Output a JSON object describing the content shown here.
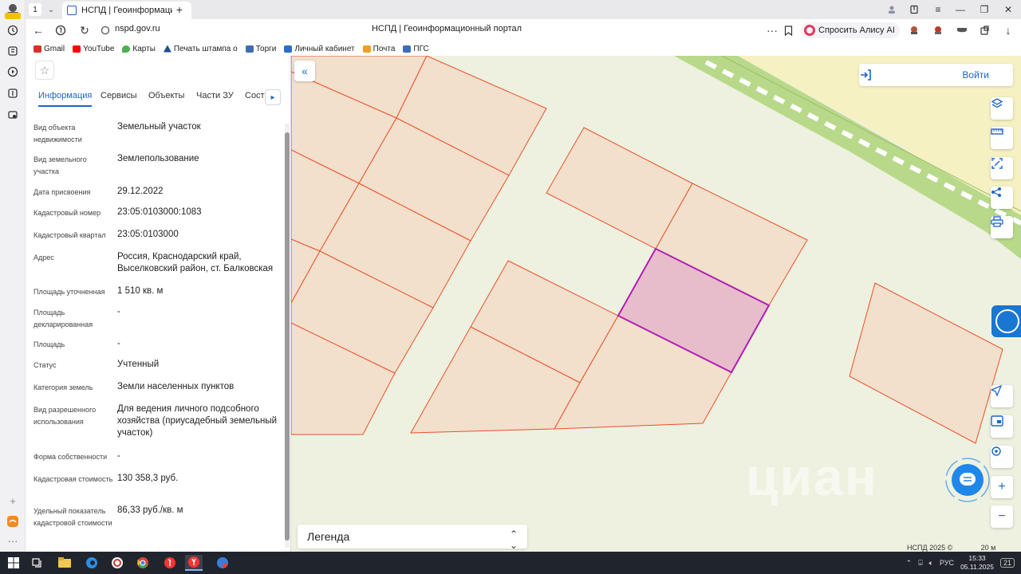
{
  "browser": {
    "profile_label": "Войти",
    "tab_count": "1",
    "active_tab_title": "НСПД | Геоинформацио",
    "url": "nspd.gov.ru",
    "page_title": "НСПД | Геоинформационный портал",
    "alisa_label": "Спросить Алису AI",
    "bookmarks": [
      {
        "label": "Gmail",
        "color": "#d93025"
      },
      {
        "label": "YouTube",
        "color": "#ff0000"
      },
      {
        "label": "Карты",
        "color": "#4caf50"
      },
      {
        "label": "Печать штампа о",
        "color": "#1e4f8a"
      },
      {
        "label": "Торги",
        "color": "#3d6db5"
      },
      {
        "label": "Личный кабинет",
        "color": "#2a6fcf"
      },
      {
        "label": "Почта",
        "color": "#f0a020"
      },
      {
        "label": "ПГС",
        "color": "#3d6db5"
      }
    ]
  },
  "panel": {
    "tabs": [
      "Информация",
      "Сервисы",
      "Объекты",
      "Части ЗУ",
      "Соста"
    ],
    "active_tab": "Информация",
    "fields": [
      {
        "label": "Вид объекта недвижимости",
        "value": "Земельный участок"
      },
      {
        "label": "Вид земельного участка",
        "value": "Землепользование"
      },
      {
        "label": "Дата присвоения",
        "value": "29.12.2022"
      },
      {
        "label": "Кадастровый номер",
        "value": "23:05:0103000:1083"
      },
      {
        "label": "Кадастровый квартал",
        "value": "23:05:0103000"
      },
      {
        "label": "Адрес",
        "value": "Россия, Краснодарский край, Выселковский район, ст. Балковская"
      },
      {
        "label": "Площадь уточненная",
        "value": "1 510 кв. м"
      },
      {
        "label": "Площадь декларированная",
        "value": "-"
      },
      {
        "label": "Площадь",
        "value": "-"
      },
      {
        "label": "Статус",
        "value": "Учтенный"
      },
      {
        "label": "Категория земель",
        "value": "Земли населенных пунктов"
      },
      {
        "label": "Вид разрешенного использования",
        "value": "Для ведения личного подсобного хозяйства (приусадебный земельный участок)"
      },
      {
        "label": "Форма собственности",
        "value": "-"
      },
      {
        "label": "Кадастровая стоимость",
        "value": "130 358,3 руб."
      },
      {
        "label": "Удельный показатель кадастровой стоимости",
        "value": "86,33 руб./кв. м"
      }
    ]
  },
  "map": {
    "login_label": "Войти",
    "legend_label": "Легенда",
    "copyright": "НСПД 2025 ©",
    "scale_label": "20 м",
    "watermark": "циан",
    "colors": {
      "parcel_fill": "#f2dfcc",
      "parcel_stroke": "#e8512a",
      "selected_fill": "#e7bccb",
      "selected_stroke": "#b11fb5",
      "ground": "#eef1e0",
      "road_green": "#b8d98a",
      "road_band": "#f5f1c2",
      "accent": "#1b67c9"
    }
  },
  "taskbar": {
    "language": "РУС",
    "time": "15:33",
    "date": "05.11.2025",
    "notifications": "21"
  }
}
